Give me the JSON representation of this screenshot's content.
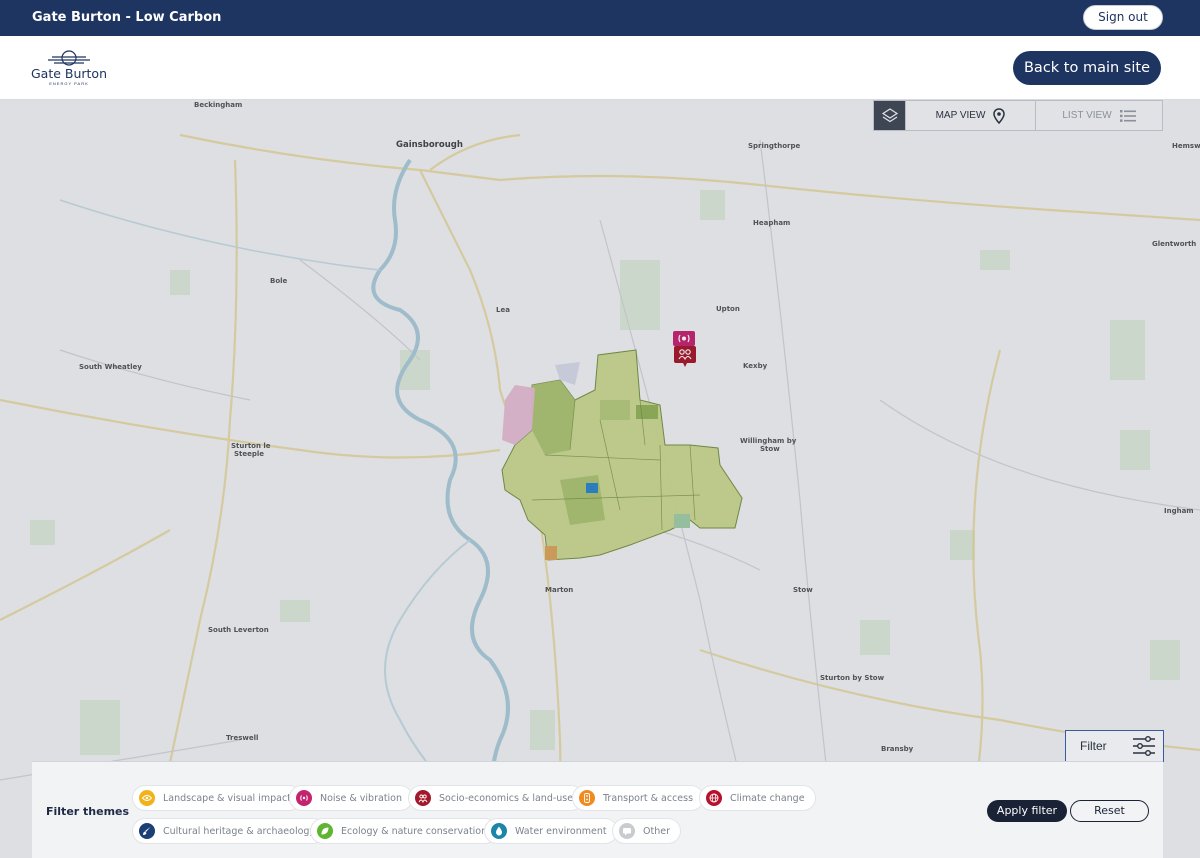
{
  "topbar": {
    "title": "Gate Burton - Low Carbon",
    "signout_label": "Sign out"
  },
  "header": {
    "logo_text": "Gate Burton",
    "logo_subtext": "ENERGY PARK",
    "back_label": "Back to main site"
  },
  "view_toggle": {
    "map_view_label": "MAP VIEW",
    "list_view_label": "LIST VIEW",
    "active": "map"
  },
  "map": {
    "places": [
      {
        "name": "Beckingham",
        "big": false
      },
      {
        "name": "Gainsborough",
        "big": true
      },
      {
        "name": "Springthorpe",
        "big": false
      },
      {
        "name": "Hemsw",
        "big": false
      },
      {
        "name": "Heapham",
        "big": false
      },
      {
        "name": "Glentworth",
        "big": false
      },
      {
        "name": "Bole",
        "big": false
      },
      {
        "name": "Upton",
        "big": false
      },
      {
        "name": "Lea",
        "big": false
      },
      {
        "name": "South Wheatley",
        "big": false
      },
      {
        "name": "Kexby",
        "big": false
      },
      {
        "name": "Sturton le",
        "big": false
      },
      {
        "name": "Steeple",
        "big": false
      },
      {
        "name": "Willingham by",
        "big": false
      },
      {
        "name": "Stow",
        "big": false
      },
      {
        "name": "Ingham",
        "big": false
      },
      {
        "name": "Marton",
        "big": false
      },
      {
        "name": "Stow",
        "big": false
      },
      {
        "name": "South Leverton",
        "big": false
      },
      {
        "name": "Sturton by Stow",
        "big": false
      },
      {
        "name": "Treswell",
        "big": false
      },
      {
        "name": "Bransby",
        "big": false
      }
    ],
    "markers": [
      "noise-vibration-marker",
      "socio-economics-marker"
    ]
  },
  "filter_button": {
    "label": "Filter"
  },
  "filter_panel": {
    "title": "Filter themes",
    "themes": [
      {
        "label": "Landscape & visual impact",
        "color": "#f2b21a",
        "icon": "eye-icon"
      },
      {
        "label": "Noise & vibration",
        "color": "#c2256e",
        "icon": "sound-icon"
      },
      {
        "label": "Socio-economics & land-use",
        "color": "#a3182a",
        "icon": "people-icon"
      },
      {
        "label": "Transport & access",
        "color": "#ef8b1f",
        "icon": "traffic-light-icon"
      },
      {
        "label": "Climate change",
        "color": "#b5122e",
        "icon": "globe-icon"
      },
      {
        "label": "Cultural heritage & archaeology",
        "color": "#1c3f75",
        "icon": "brush-icon"
      },
      {
        "label": "Ecology & nature conservation",
        "color": "#5fb532",
        "icon": "leaf-icon"
      },
      {
        "label": "Water environment",
        "color": "#1b86a8",
        "icon": "water-drop-icon"
      },
      {
        "label": "Other",
        "color": "#c9cbd0",
        "icon": "chat-icon"
      }
    ],
    "apply_label": "Apply filter",
    "reset_label": "Reset"
  }
}
